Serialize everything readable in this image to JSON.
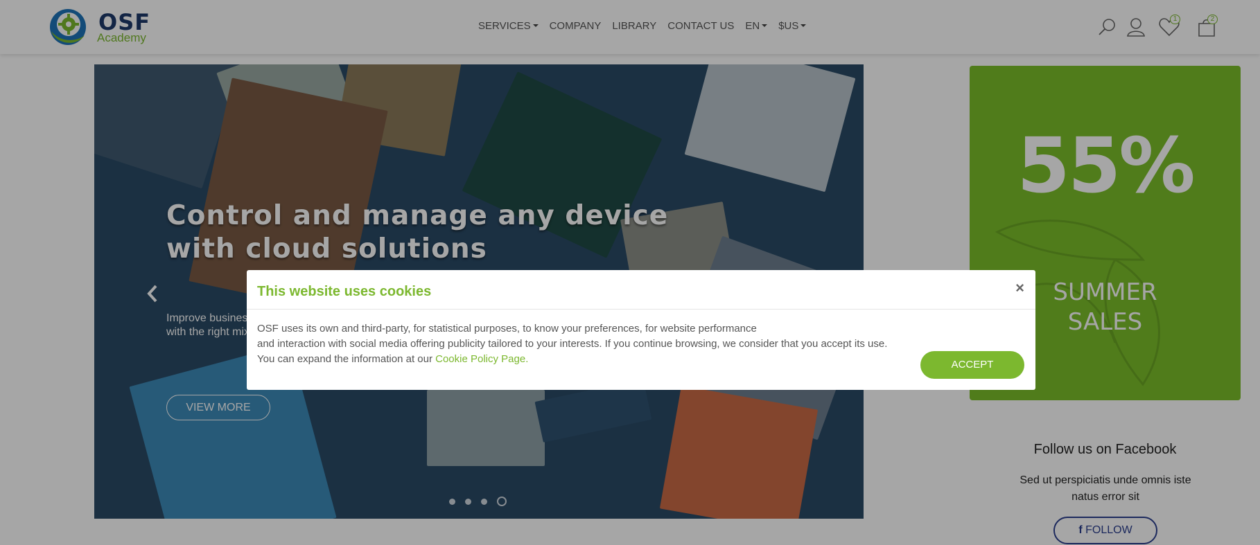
{
  "header": {
    "logo": {
      "brand": "OSF",
      "sub": "Academy"
    },
    "nav": [
      {
        "label": "SERVICES",
        "has_caret": true
      },
      {
        "label": "COMPANY",
        "has_caret": false
      },
      {
        "label": "LIBRARY",
        "has_caret": false
      },
      {
        "label": "CONTACT US",
        "has_caret": false
      },
      {
        "label": "EN",
        "has_caret": true
      },
      {
        "label": "$US",
        "has_caret": true
      }
    ],
    "icons": {
      "search": "search-icon",
      "account": "user-icon",
      "wishlist": "heart-icon",
      "cart": "shopping-bag-icon"
    },
    "wishlist_count": "1",
    "cart_count": "2"
  },
  "hero": {
    "title": "Control and manage any device with cloud solutions",
    "subtitle_line1": "Improve busines",
    "subtitle_line2": "with the right mix",
    "button": "VIEW MORE",
    "slides_count": 4,
    "active_slide": 4
  },
  "promo": {
    "percent": "55%",
    "line1": "SUMMER",
    "line2": "SALES"
  },
  "facebook": {
    "title": "Follow us on Facebook",
    "description": "Sed ut perspiciatis unde omnis iste natus error sit",
    "button": "FOLLOW"
  },
  "cookie_modal": {
    "title": "This website uses cookies",
    "close": "×",
    "line1": "OSF uses its own and third-party, for statistical purposes, to know your preferences, for website performance",
    "line2": "and interaction with social media offering publicity tailored to your interests. If you continue browsing, we consider that you accept its use.",
    "line3_prefix": "You can expand the information at our ",
    "link": "Cookie Policy Page.",
    "accept": "ACCEPT"
  },
  "colors": {
    "brand_green": "#7cb82f",
    "brand_navy": "#1e3a6b",
    "facebook_blue": "#2c3f8f"
  }
}
